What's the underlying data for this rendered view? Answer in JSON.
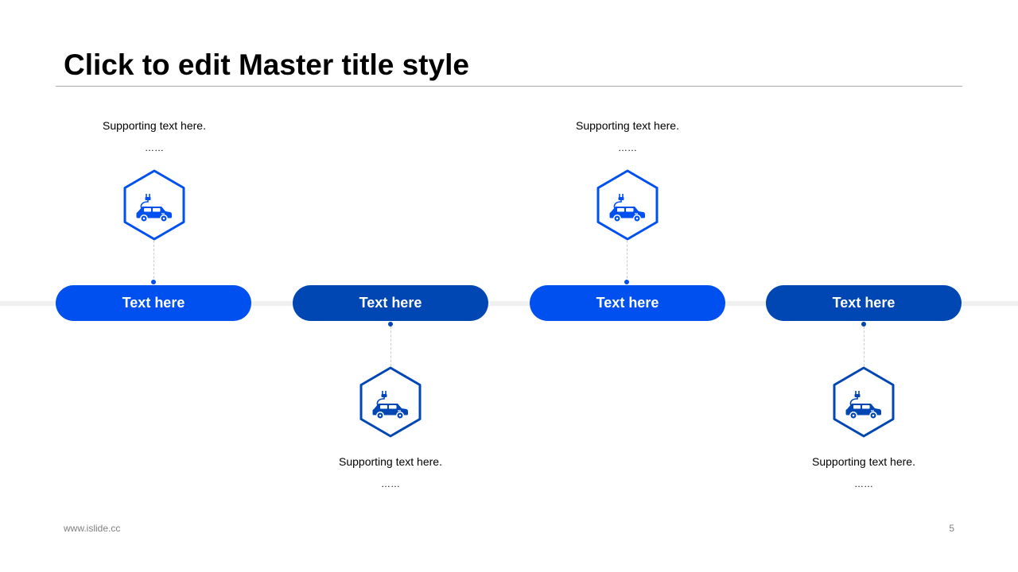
{
  "slide": {
    "title": "Click to edit Master title style"
  },
  "colors": {
    "primary_blue": "#0050f0",
    "dark_blue": "#0047b3",
    "track_gray": "#f0f0f0"
  },
  "steps": [
    {
      "label": "Text here",
      "supporting_text": "Supporting  text here.",
      "ellipsis": "……",
      "icon": "electric-car-icon",
      "color": "#0050f0",
      "icon_position": "above"
    },
    {
      "label": "Text here",
      "supporting_text": "Supporting  text here.",
      "ellipsis": "……",
      "icon": "electric-car-icon",
      "color": "#0047b3",
      "icon_position": "below"
    },
    {
      "label": "Text here",
      "supporting_text": "Supporting  text here.",
      "ellipsis": "……",
      "icon": "electric-car-icon",
      "color": "#0050f0",
      "icon_position": "above"
    },
    {
      "label": "Text here",
      "supporting_text": "Supporting  text here.",
      "ellipsis": "……",
      "icon": "electric-car-icon",
      "color": "#0047b3",
      "icon_position": "below"
    }
  ],
  "footer": {
    "url": "www.islide.cc",
    "page_number": "5"
  }
}
